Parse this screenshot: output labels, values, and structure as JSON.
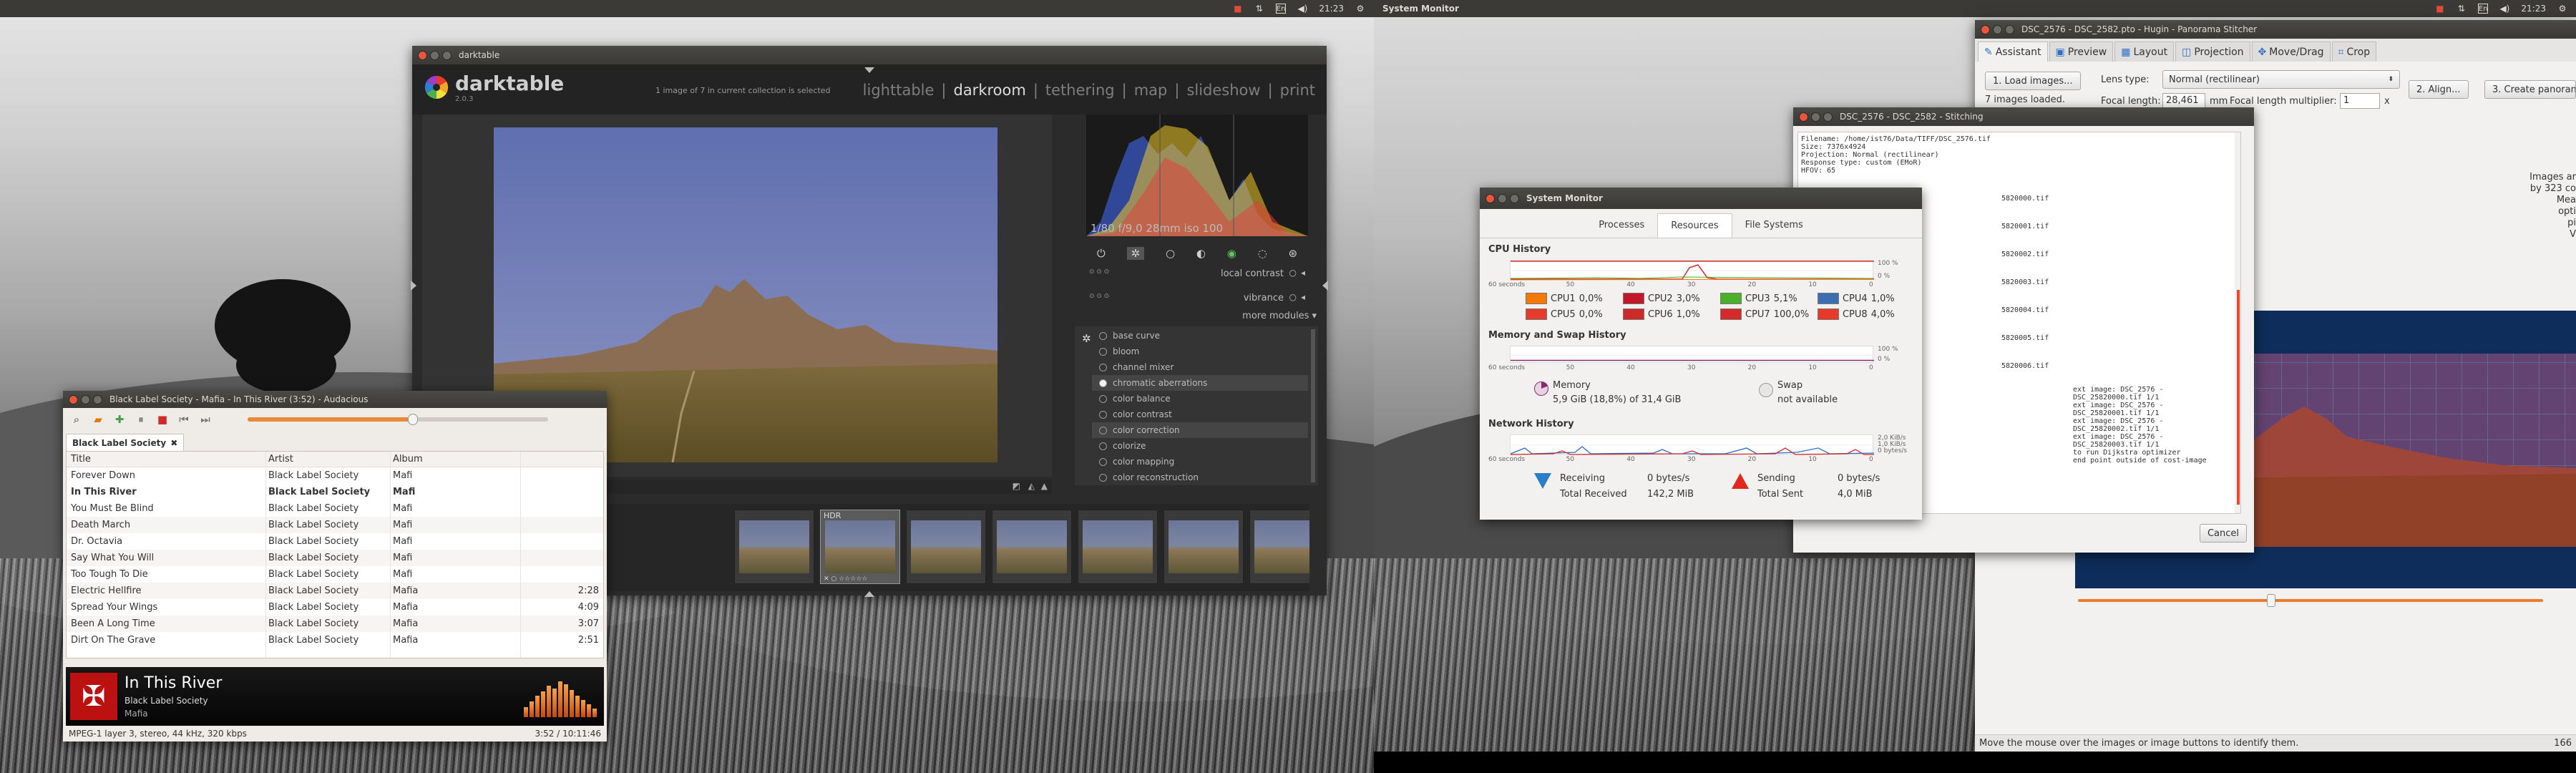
{
  "left_panel": {
    "time": "21:23"
  },
  "right_panel": {
    "app_name": "System Monitor",
    "time": "21:23"
  },
  "darktable": {
    "window_title": "darktable",
    "logo": {
      "name": "darktable",
      "version": "2.0.3"
    },
    "collection_info": "1 image of 7 in current collection is selected",
    "views": [
      "lighttable",
      "|",
      "darkroom",
      "|",
      "tethering",
      "|",
      "map",
      "|",
      "slideshow",
      "|",
      "print"
    ],
    "active_view": "darkroom",
    "exif": "1/80 f/9,0 28mm iso 100",
    "sliders": [
      {
        "label": "local contrast"
      },
      {
        "label": "vibrance"
      }
    ],
    "more_modules": "more modules",
    "modules": [
      "base curve",
      "bloom",
      "channel mixer",
      "chromatic aberrations",
      "color balance",
      "color contrast",
      "color correction",
      "colorize",
      "color mapping",
      "color reconstruction"
    ],
    "highlighted_modules": [
      "chromatic aberrations",
      "color correction"
    ],
    "filmstrip_selected_label": "HDR",
    "filmstrip_count": 7
  },
  "audacious": {
    "window_title": "Black Label Society - Mafia - In This River (3:52) - Audacious",
    "tab_label": "Black Label Society",
    "columns": [
      "Title",
      "Artist",
      "Album"
    ],
    "rows": [
      {
        "title": "Forever Down",
        "artist": "Black Label Society",
        "album": "Mafi",
        "time": ""
      },
      {
        "title": "In This River",
        "artist": "Black Label Society",
        "album": "Mafi",
        "time": ""
      },
      {
        "title": "You Must Be Blind",
        "artist": "Black Label Society",
        "album": "Mafi",
        "time": ""
      },
      {
        "title": "Death March",
        "artist": "Black Label Society",
        "album": "Mafi",
        "time": ""
      },
      {
        "title": "Dr. Octavia",
        "artist": "Black Label Society",
        "album": "Mafi",
        "time": ""
      },
      {
        "title": "Say What You Will",
        "artist": "Black Label Society",
        "album": "Mafi",
        "time": ""
      },
      {
        "title": "Too Tough To Die",
        "artist": "Black Label Society",
        "album": "Mafi",
        "time": ""
      },
      {
        "title": "Electric Hellfire",
        "artist": "Black Label Society",
        "album": "Mafia",
        "time": "2:28"
      },
      {
        "title": "Spread Your Wings",
        "artist": "Black Label Society",
        "album": "Mafia",
        "time": "4:09"
      },
      {
        "title": "Been A Long Time",
        "artist": "Black Label Society",
        "album": "Mafia",
        "time": "3:07"
      },
      {
        "title": "Dirt On The Grave",
        "artist": "Black Label Society",
        "album": "Mafia",
        "time": "2:51"
      }
    ],
    "playing_index": 1,
    "now_playing": {
      "title": "In This River",
      "artist": "Black Label Society",
      "album": "Mafia"
    },
    "status_left": "MPEG-1 layer 3, stereo, 44 kHz, 320 kbps",
    "status_right": "3:52 / 10:11:46",
    "volume_level": 0.55
  },
  "system_monitor": {
    "window_title": "System Monitor",
    "tabs": [
      "Processes",
      "Resources",
      "File Systems"
    ],
    "active_tab": "Resources",
    "cpu": {
      "title": "CPU History",
      "y_labels": [
        "100 %",
        "0 %"
      ],
      "x_labels": [
        "60 seconds",
        "50",
        "40",
        "30",
        "20",
        "10",
        "0"
      ],
      "cores": [
        {
          "name": "CPU1",
          "value": "0,0%",
          "color": "#f57900"
        },
        {
          "name": "CPU2",
          "value": "3,0%",
          "color": "#c2182a"
        },
        {
          "name": "CPU3",
          "value": "5,1%",
          "color": "#4caf2a"
        },
        {
          "name": "CPU4",
          "value": "1,0%",
          "color": "#3a6fb4"
        },
        {
          "name": "CPU5",
          "value": "0,0%",
          "color": "#e23d2a"
        },
        {
          "name": "CPU6",
          "value": "1,0%",
          "color": "#cf2a2a"
        },
        {
          "name": "CPU7",
          "value": "100,0%",
          "color": "#d42a2a"
        },
        {
          "name": "CPU8",
          "value": "4,0%",
          "color": "#e83a2a"
        }
      ]
    },
    "memory": {
      "title": "Memory and Swap History",
      "y_labels": [
        "100 %",
        "0 %"
      ],
      "x_labels": [
        "60 seconds",
        "50",
        "40",
        "30",
        "20",
        "10",
        "0"
      ],
      "memory_label": "Memory",
      "memory_value": "5,9 GiB (18,8%) of 31,4 GiB",
      "swap_label": "Swap",
      "swap_value": "not available"
    },
    "network": {
      "title": "Network History",
      "y_labels": [
        "2,0 KiB/s",
        "1,0 KiB/s",
        "0 bytes/s"
      ],
      "x_labels": [
        "60 seconds",
        "50",
        "40",
        "30",
        "20",
        "10",
        "0"
      ],
      "receiving_label": "Receiving",
      "receiving_value": "0 bytes/s",
      "total_received_label": "Total Received",
      "total_received_value": "142,2 MiB",
      "sending_label": "Sending",
      "sending_value": "0 bytes/s",
      "total_sent_label": "Total Sent",
      "total_sent_value": "4,0 MiB"
    }
  },
  "hugin": {
    "window_title": "DSC_2576 - DSC_2582.pto - Hugin - Panorama Stitcher",
    "tabs": [
      "Assistant",
      "Preview",
      "Layout",
      "Projection",
      "Move/Drag",
      "Crop"
    ],
    "active_tab": "Assistant",
    "load_button": "1. Load images...",
    "images_loaded": "7 images loaded.",
    "lens_type_label": "Lens type:",
    "lens_type_value": "Normal (rectilinear)",
    "focal_length_label": "Focal length:",
    "focal_length_value": "28,461",
    "focal_unit": "mm",
    "multiplier_label": "Focal length multiplier:",
    "multiplier_value": "1",
    "multiplier_unit": "x",
    "align_button": "2. Align...",
    "create_button": "3. Create panoram",
    "info_lines": [
      "Images ar",
      "by 323 co",
      "Mea",
      "opti",
      "pi",
      "V"
    ],
    "status_bar": "Move the mouse over the images or image buttons to identify them.",
    "status_right": "166"
  },
  "stitching": {
    "window_title": "DSC_2576 - DSC_2582 - Stitching",
    "log_header": [
      "Filename: /home/ist76/Data/TIFF/DSC_2576.tif",
      "Size: 7376x4924",
      "Projection: Normal (rectilinear)",
      "Response type: custom (EMoR)",
      "HFOV: 65"
    ],
    "log_mid": [
      "5820000.tif",
      "5820001.tif",
      "5820002.tif",
      "5820003.tif",
      "5820004.tif",
      "5820005.tif",
      "5820006.tif"
    ],
    "log_tail": [
      "ext image: DSC_2576 - DSC_25820000.tif 1/1",
      "ext image: DSC_2576 - DSC_25820001.tif 1/1",
      "ext image: DSC_2576 - DSC_25820002.tif 1/1",
      "ext image: DSC_2576 - DSC_25820003.tif 1/1",
      "to run Dijkstra optimizer",
      "end point outside of cost-image"
    ],
    "cancel_button": "Cancel"
  }
}
